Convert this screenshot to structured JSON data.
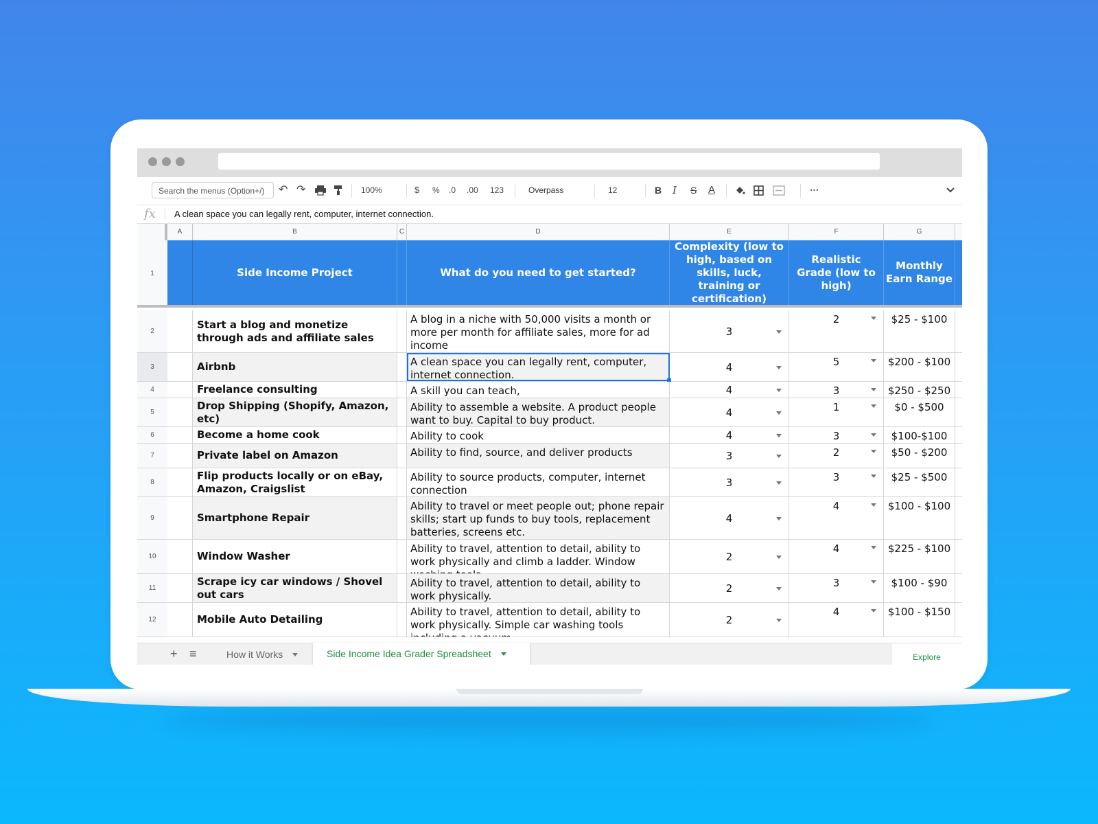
{
  "toolbar": {
    "search_placeholder": "Search the menus (Option+/)",
    "zoom": "100%",
    "currency": "$",
    "percent": "%",
    "decrease_decimal": ".0",
    "increase_decimal": ".00",
    "more_formats": "123",
    "font": "Overpass",
    "font_size": "12",
    "bold": "B",
    "italic": "I",
    "strike": "S",
    "text_color": "A",
    "more": "⋯"
  },
  "formula_bar": {
    "fx": "fx",
    "content": "A clean space you can legally rent, computer, internet connection."
  },
  "columns": [
    "A",
    "B",
    "C",
    "D",
    "E",
    "F",
    "G"
  ],
  "header": {
    "b": "Side Income Project",
    "d": "What do you need to get started?",
    "e": "Complexity (low to high, based on skills, luck, training or certification)",
    "f": "Realistic Grade (low to high)",
    "g": "Monthly Earn Range"
  },
  "rows": [
    {
      "num": "2",
      "b": "Start a blog and monetize through ads and affiliate sales",
      "d": "A blog in a niche with 50,000 visits a month or more per month for affiliate sales, more for ad income",
      "e": "3",
      "f": "2",
      "g": "$25 - $100"
    },
    {
      "num": "3",
      "b": "Airbnb",
      "d": "A clean space you can legally rent, computer, internet connection.",
      "e": "4",
      "f": "5",
      "g": "$200 - $100"
    },
    {
      "num": "4",
      "b": "Freelance consulting",
      "d": "A skill you can teach,",
      "e": "4",
      "f": "3",
      "g": "$250 - $250"
    },
    {
      "num": "5",
      "b": "Drop Shipping (Shopify, Amazon, etc)",
      "d": "Ability to assemble a website. A product people want to buy. Capital to buy product.",
      "e": "4",
      "f": "1",
      "g": "$0 - $500"
    },
    {
      "num": "6",
      "b": "Become a home cook",
      "d": "Ability to cook",
      "e": "4",
      "f": "3",
      "g": "$100-$100"
    },
    {
      "num": "7",
      "b": "Private label on Amazon",
      "d": "Ability to find, source, and deliver products",
      "e": "3",
      "f": "2",
      "g": "$50 - $200"
    },
    {
      "num": "8",
      "b": "Flip products locally or on eBay, Amazon, Craigslist",
      "d": "Ability to source products, computer, internet connection",
      "e": "3",
      "f": "3",
      "g": "$25 - $500"
    },
    {
      "num": "9",
      "b": "Smartphone Repair",
      "d": "Ability to travel or meet people out; phone repair skills; start up funds to buy tools, replacement batteries, screens etc.",
      "e": "4",
      "f": "4",
      "g": "$100 - $100"
    },
    {
      "num": "10",
      "b": "Window Washer",
      "d": "Ability to travel, attention to detail, ability to work physically and climb a ladder. Window washing tools.",
      "e": "2",
      "f": "4",
      "g": "$225 - $100"
    },
    {
      "num": "11",
      "b": "Scrape icy car windows / Shovel out cars",
      "d": "Ability to travel, attention to detail, ability to work physically.",
      "e": "2",
      "f": "3",
      "g": "$100 - $90"
    },
    {
      "num": "12",
      "b": "Mobile Auto Detailing",
      "d": "Ability to travel, attention to detail, ability to work physically. Simple car washing tools including a vacuum.",
      "e": "2",
      "f": "4",
      "g": "$100 - $150"
    }
  ],
  "tabs": {
    "add": "+",
    "list": "≡",
    "inactive": "How it Works",
    "active": "Side Income Idea Grader Spreadsheet",
    "explore": "Explore"
  },
  "colors": {
    "header_blue": "#2f86e6",
    "active_tab_green": "#1e8e3e",
    "selection_blue": "#1a73e8"
  }
}
